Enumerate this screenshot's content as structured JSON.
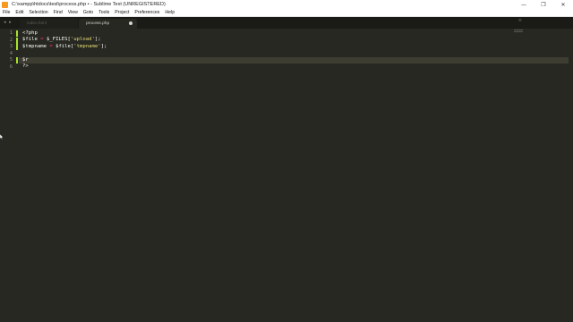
{
  "window": {
    "title": "C:\\xampp\\htdocs\\test\\process.php • - Sublime Text (UNREGISTERED)",
    "controls": [
      "—",
      "❐",
      "✕"
    ]
  },
  "menu": [
    "File",
    "Edit",
    "Selection",
    "Find",
    "View",
    "Goto",
    "Tools",
    "Project",
    "Preferences",
    "Help"
  ],
  "tabbar": {
    "arrows": "◂ ▸",
    "menu_glyph": "≡",
    "tabs": [
      {
        "label": "index.html",
        "active": false
      },
      {
        "label": "process.php",
        "active": true,
        "modified": true
      }
    ]
  },
  "editor": {
    "current_line": 5,
    "line_numbers": [
      "1",
      "2",
      "3",
      "4",
      "5",
      "6"
    ],
    "lines": [
      [
        {
          "t": "<?php",
          "c": "plain"
        }
      ],
      [
        {
          "t": "$file",
          "c": "var"
        },
        {
          "t": " ",
          "c": "plain"
        },
        {
          "t": "=",
          "c": "op"
        },
        {
          "t": " $_FILES[",
          "c": "plain"
        },
        {
          "t": "'upload'",
          "c": "str"
        },
        {
          "t": "];",
          "c": "plain"
        }
      ],
      [
        {
          "t": "$tmpname",
          "c": "var"
        },
        {
          "t": " ",
          "c": "plain"
        },
        {
          "t": "=",
          "c": "op"
        },
        {
          "t": " $file[",
          "c": "plain"
        },
        {
          "t": "'tmpname'",
          "c": "str"
        },
        {
          "t": "];",
          "c": "plain"
        }
      ],
      [],
      [
        {
          "t": "$r",
          "c": "var"
        }
      ],
      [
        {
          "t": "?>",
          "c": "plain"
        }
      ]
    ],
    "modified_lines": [
      1,
      2,
      3,
      5
    ]
  }
}
